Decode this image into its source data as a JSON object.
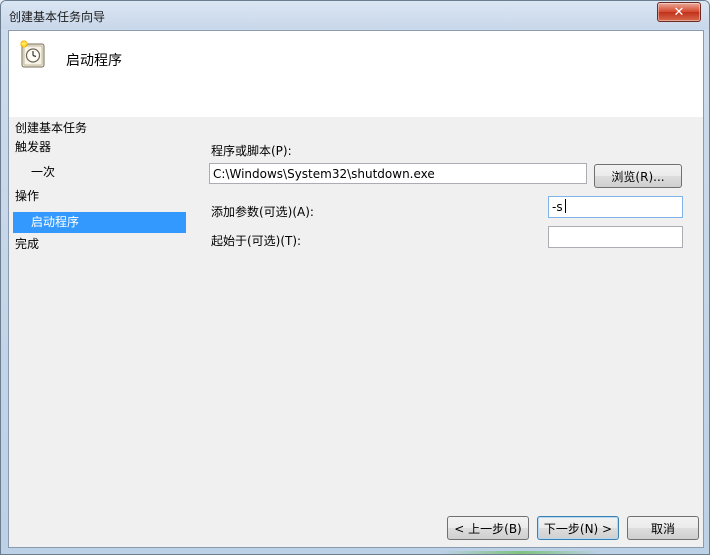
{
  "window": {
    "title": "创建基本任务向导",
    "close_glyph": "✕"
  },
  "header": {
    "title": "启动程序",
    "icon": "clock-task-icon"
  },
  "nav": {
    "title": "创建基本任务",
    "items": [
      {
        "label": "触发器",
        "indent": false,
        "selected": false
      },
      {
        "label": "一次",
        "indent": true,
        "selected": false
      },
      {
        "label": "操作",
        "indent": false,
        "selected": false
      },
      {
        "label": "启动程序",
        "indent": true,
        "selected": true
      },
      {
        "label": "完成",
        "indent": false,
        "selected": false
      }
    ]
  },
  "form": {
    "program_label": "程序或脚本(P):",
    "program_value": "C:\\Windows\\System32\\shutdown.exe",
    "browse_label": "浏览(R)...",
    "args_label": "添加参数(可选)(A):",
    "args_value": "-s",
    "startin_label": "起始于(可选)(T):",
    "startin_value": ""
  },
  "footer": {
    "back_label": "< 上一步(B)",
    "next_label": "下一步(N) >",
    "cancel_label": "取消"
  },
  "colors": {
    "selection": "#3399ff",
    "close_button": "#c0311a"
  }
}
